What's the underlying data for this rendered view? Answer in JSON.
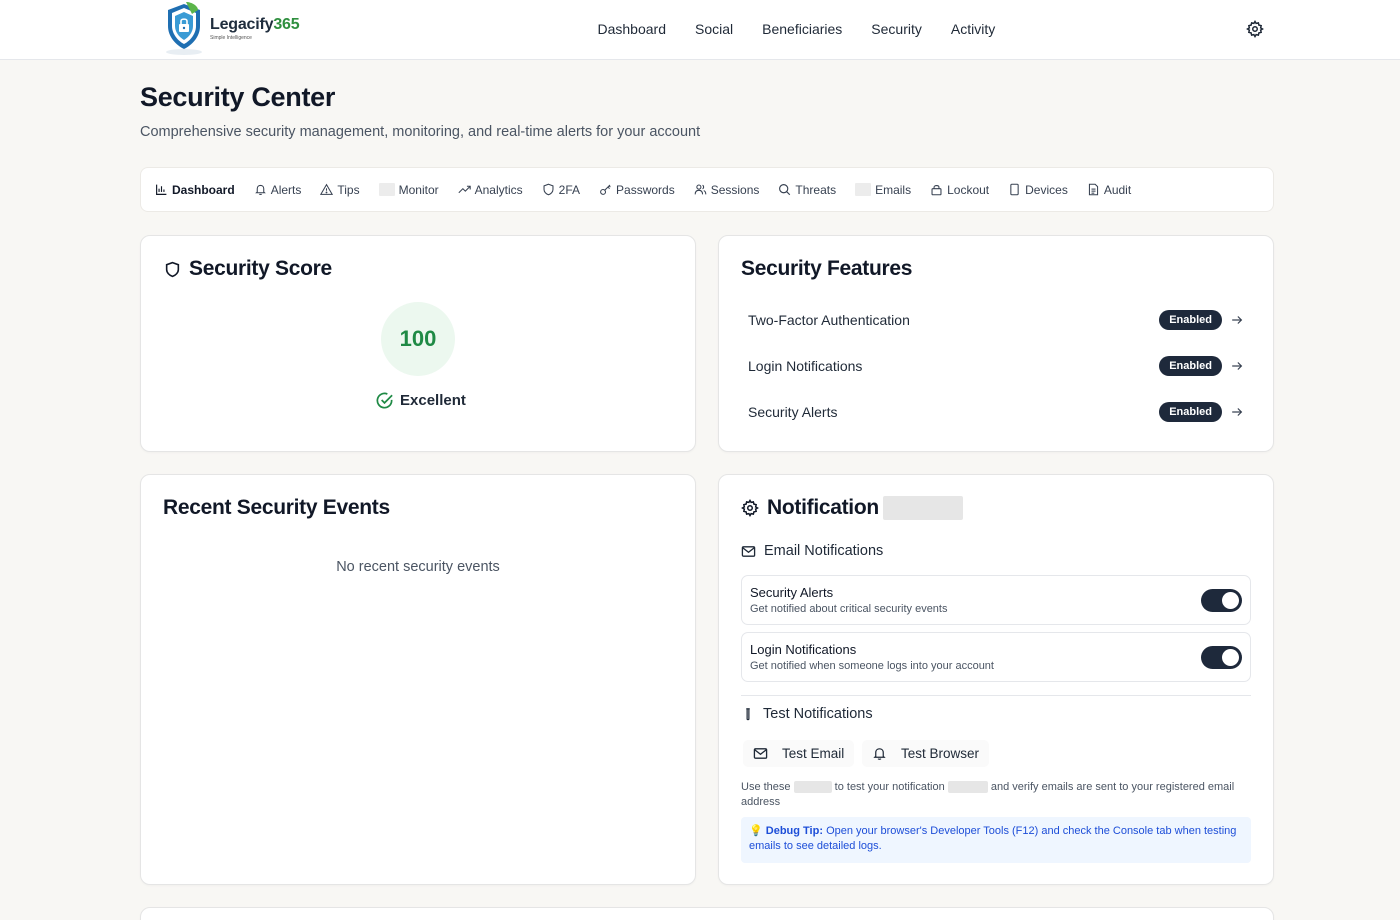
{
  "brand": {
    "name": "Legacify",
    "name_num": "365",
    "tagline": "Simple Intelligence"
  },
  "nav": {
    "links": [
      "Dashboard",
      "Social",
      "Beneficiaries",
      "Security",
      "Activity"
    ]
  },
  "header": {
    "title": "Security Center",
    "subtitle": "Comprehensive security management, monitoring, and real-time alerts for your account"
  },
  "tabs": [
    {
      "label": "Dashboard",
      "icon": "bar-chart-icon"
    },
    {
      "label": "Alerts",
      "icon": "bell-icon"
    },
    {
      "label": "Tips",
      "icon": "warning-icon"
    },
    {
      "label": "Monitor",
      "icon": "blank"
    },
    {
      "label": "Analytics",
      "icon": "trend-icon"
    },
    {
      "label": "2FA",
      "icon": "shield-icon"
    },
    {
      "label": "Passwords",
      "icon": "key-icon"
    },
    {
      "label": "Sessions",
      "icon": "users-icon"
    },
    {
      "label": "Threats",
      "icon": "search-icon"
    },
    {
      "label": "Emails",
      "icon": "blank"
    },
    {
      "label": "Lockout",
      "icon": "lock-icon"
    },
    {
      "label": "Devices",
      "icon": "device-icon"
    },
    {
      "label": "Audit",
      "icon": "document-icon"
    }
  ],
  "score": {
    "title": "Security Score",
    "value": "100",
    "label": "Excellent"
  },
  "features": {
    "title": "Security Features",
    "items": [
      {
        "name": "Two-Factor Authentication",
        "status": "Enabled"
      },
      {
        "name": "Login Notifications",
        "status": "Enabled"
      },
      {
        "name": "Security Alerts",
        "status": "Enabled"
      }
    ]
  },
  "events": {
    "title": "Recent Security Events",
    "empty": "No recent security events"
  },
  "notifications": {
    "title": "Notification",
    "email_heading": "Email Notifications",
    "toggles": [
      {
        "title": "Security Alerts",
        "desc": "Get notified about critical security events",
        "on": true
      },
      {
        "title": "Login Notifications",
        "desc": "Get notified when someone logs into your account",
        "on": true
      }
    ],
    "test_heading": "Test Notifications",
    "test_email": "Test Email",
    "test_browser": "Test Browser",
    "help_part1": "Use these",
    "help_part2": "to test your notification",
    "help_part3": "and verify emails are sent to your registered email address",
    "tip_label": "Debug Tip:",
    "tip_text": "Open your browser's Developer Tools (F12) and check the Console tab when testing emails to see detailed logs."
  },
  "colors": {
    "score_green": "#1f8a45",
    "badge_dark": "#1e293b",
    "tip_blue": "#1d4ed8"
  }
}
